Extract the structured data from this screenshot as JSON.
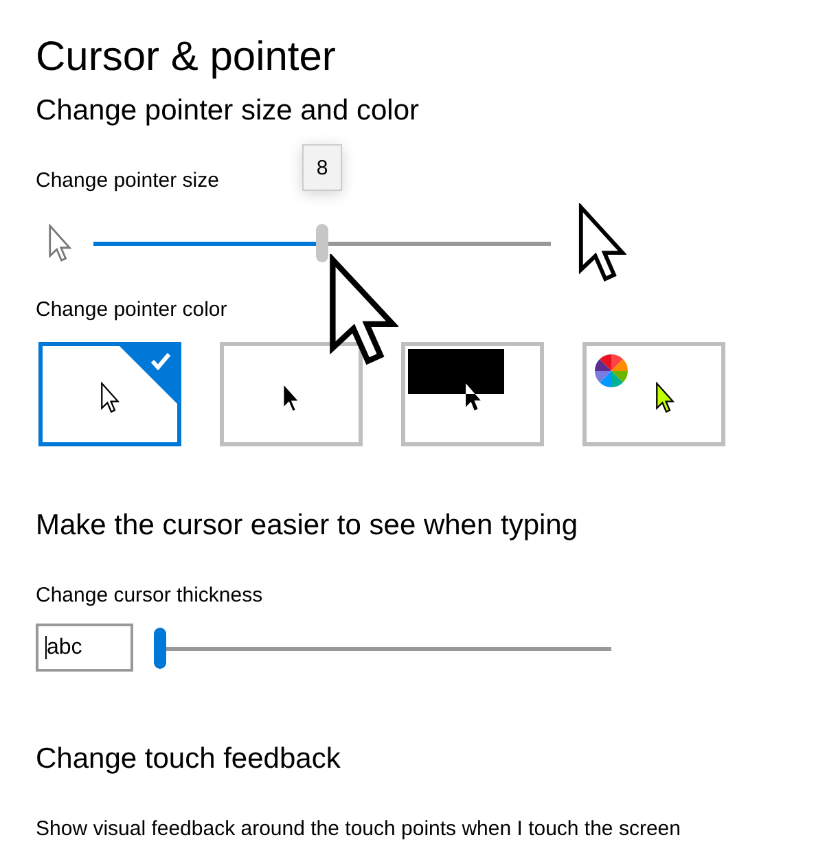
{
  "page": {
    "title": "Cursor & pointer",
    "subtitle": "Change pointer size and color"
  },
  "pointer_size": {
    "label": "Change pointer size",
    "tooltip": "8",
    "level": 0.5
  },
  "pointer_color": {
    "label": "Change pointer color",
    "options": [
      {
        "kind": "white",
        "selected": true
      },
      {
        "kind": "black",
        "selected": false
      },
      {
        "kind": "inverted",
        "selected": false
      },
      {
        "kind": "custom",
        "selected": false
      }
    ]
  },
  "typing": {
    "heading": "Make the cursor easier to see when typing",
    "label": "Change cursor thickness",
    "preview": "abc",
    "level": 0
  },
  "touch": {
    "heading": "Change touch feedback",
    "description": "Show visual feedback around the touch points when I touch the screen"
  }
}
